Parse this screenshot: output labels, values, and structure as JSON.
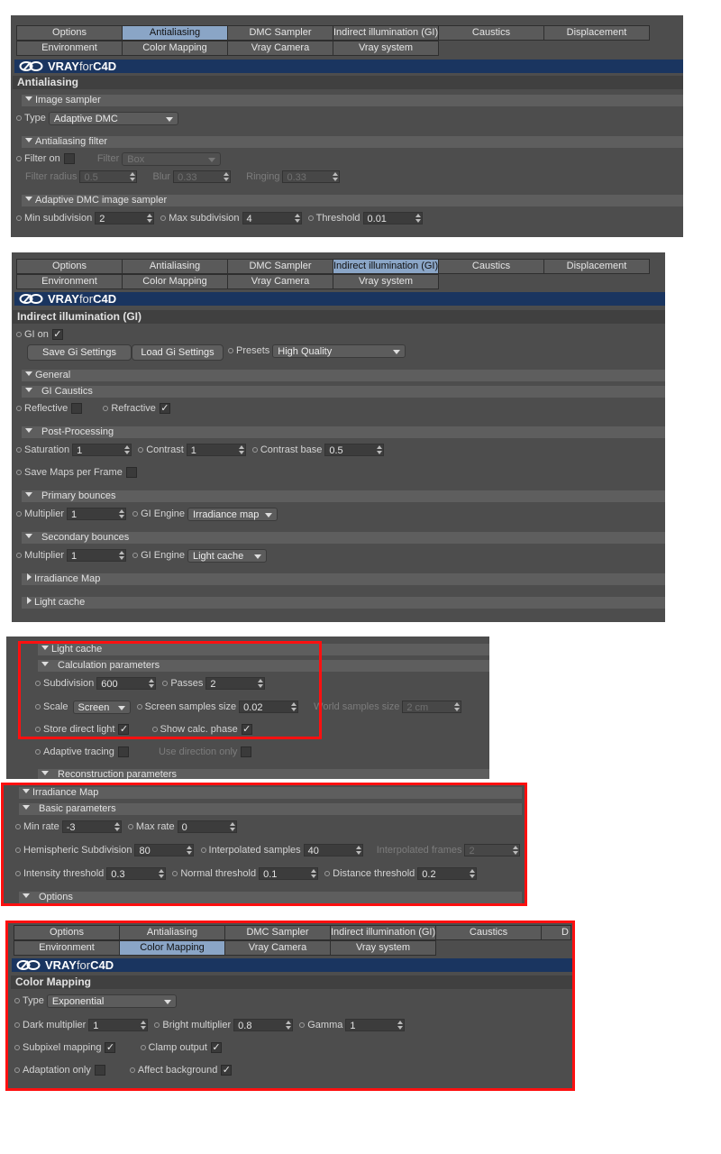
{
  "tabs_row1": [
    "Options",
    "Antialiasing",
    "DMC Sampler",
    "Indirect illumination (GI)",
    "Caustics",
    "Displacement"
  ],
  "tabs_row2": [
    "Environment",
    "Color Mapping",
    "Vray Camera",
    "Vray system"
  ],
  "tabs_row1_cut": [
    "Options",
    "Antialiasing",
    "DMC Sampler",
    "Indirect illumination (GI)",
    "Caustics",
    "D"
  ],
  "brand": {
    "vray": "VRAY",
    "for": "for",
    "c4d": "C4D"
  },
  "aa": {
    "title": "Antialiasing",
    "image_sampler": "Image sampler",
    "type_label": "Type",
    "type_value": "Adaptive DMC",
    "filter_section": "Antialiasing filter",
    "filter_on": "Filter on",
    "filter_label": "Filter",
    "filter_value": "Box",
    "filter_radius_label": "Filter radius",
    "filter_radius": "0.5",
    "blur_label": "Blur",
    "blur": "0.33",
    "ringing_label": "Ringing",
    "ringing": "0.33",
    "dmc_section": "Adaptive DMC image sampler",
    "min_sub_label": "Min subdivision",
    "min_sub": "2",
    "max_sub_label": "Max subdivision",
    "max_sub": "4",
    "threshold_label": "Threshold",
    "threshold": "0.01"
  },
  "gi": {
    "title": "Indirect illumination (GI)",
    "gi_on": "GI on",
    "save_btn": "Save Gi Settings",
    "load_btn": "Load Gi Settings",
    "presets_label": "Presets",
    "presets_value": "High Quality",
    "general": "General",
    "gi_caustics": "GI Caustics",
    "reflective": "Reflective",
    "refractive": "Refractive",
    "post": "Post-Processing",
    "saturation_label": "Saturation",
    "saturation": "1",
    "contrast_label": "Contrast",
    "contrast": "1",
    "contrast_base_label": "Contrast base",
    "contrast_base": "0.5",
    "save_maps": "Save Maps per Frame",
    "primary": "Primary bounces",
    "multiplier_label": "Multiplier",
    "p_multiplier": "1",
    "engine_label": "GI Engine",
    "p_engine": "Irradiance map",
    "secondary": "Secondary bounces",
    "s_multiplier": "1",
    "s_engine": "Light cache",
    "irradiance_map": "Irradiance Map",
    "light_cache": "Light cache"
  },
  "lc": {
    "title": "Light cache",
    "calc": "Calculation parameters",
    "subdivision_label": "Subdivision",
    "subdivision": "600",
    "passes_label": "Passes",
    "passes": "2",
    "scale_label": "Scale",
    "scale_value": "Screen",
    "screen_samples_label": "Screen samples size",
    "screen_samples": "0.02",
    "world_samples_label": "World samples size",
    "world_samples": "2 cm",
    "store_direct": "Store direct light",
    "show_calc": "Show calc. phase",
    "adaptive": "Adaptive tracing",
    "use_direction": "Use direction only",
    "reconstruction": "Reconstruction parameters"
  },
  "im": {
    "title": "Irradiance Map",
    "basic": "Basic parameters",
    "min_rate_label": "Min rate",
    "min_rate": "-3",
    "max_rate_label": "Max rate",
    "max_rate": "0",
    "hemi_label": "Hemispheric Subdivision",
    "hemi": "80",
    "interp_label": "Interpolated samples",
    "interp": "40",
    "interp_frames_label": "Interpolated frames",
    "interp_frames": "2",
    "intensity_label": "Intensity threshold",
    "intensity": "0.3",
    "normal_label": "Normal threshold",
    "normal": "0.1",
    "distance_label": "Distance threshold",
    "distance": "0.2",
    "options": "Options"
  },
  "cm": {
    "title": "Color Mapping",
    "type_label": "Type",
    "type_value": "Exponential",
    "dark_label": "Dark multiplier",
    "dark": "1",
    "bright_label": "Bright multiplier",
    "bright": "0.8",
    "gamma_label": "Gamma",
    "gamma": "1",
    "subpixel": "Subpixel mapping",
    "clamp": "Clamp output",
    "adaptation": "Adaptation only",
    "affect_bg": "Affect background"
  },
  "checkmark": "✓",
  "colors": {
    "panel": "#4d4d4d",
    "brand_bar": "#1a3560",
    "active_tab": "#8aa5c6",
    "highlight_box": "#ff1010"
  }
}
